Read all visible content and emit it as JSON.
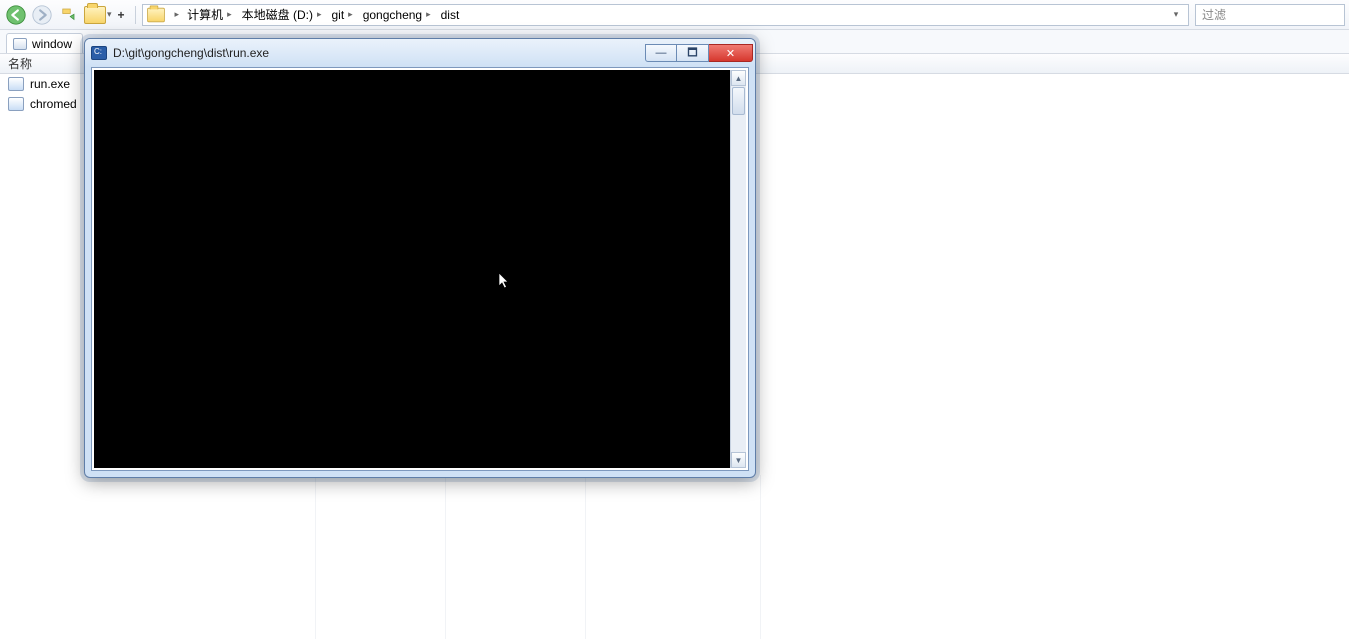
{
  "nav": {
    "plus": "+"
  },
  "breadcrumb": {
    "items": [
      {
        "label": "计算机"
      },
      {
        "label": "本地磁盘 (D:)"
      },
      {
        "label": "git"
      },
      {
        "label": "gongcheng"
      },
      {
        "label": "dist"
      }
    ]
  },
  "filter": {
    "placeholder": "过滤"
  },
  "tab": {
    "label": "window"
  },
  "columns": {
    "name": "名称"
  },
  "files": [
    {
      "name": "run.exe",
      "kind": "exe"
    },
    {
      "name": "chromed",
      "kind": "exe"
    }
  ],
  "console": {
    "title": "D:\\git\\gongcheng\\dist\\run.exe",
    "buttons": {
      "minimize": "—",
      "maximize": "🗖",
      "close": "✕"
    }
  }
}
